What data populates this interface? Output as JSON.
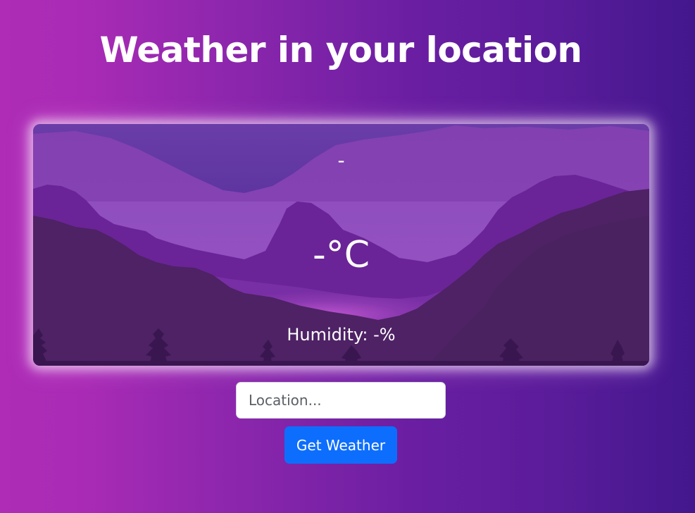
{
  "header": {
    "title": "Weather in your location"
  },
  "weather_card": {
    "city": "-",
    "temperature": "-°C",
    "humidity": "Humidity: -%"
  },
  "form": {
    "location_placeholder": "Location...",
    "location_value": "",
    "submit_label": "Get Weather"
  },
  "colors": {
    "button": "#0d6efd",
    "text": "#ffffff"
  }
}
